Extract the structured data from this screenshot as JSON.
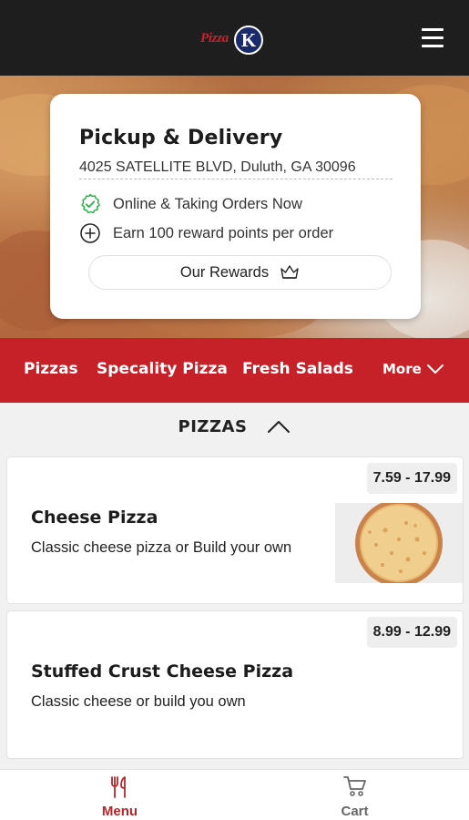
{
  "header": {
    "logo_text": "Pizza",
    "logo_letter": "K",
    "menu_icon": "hamburger-icon"
  },
  "store_card": {
    "title": "Pickup & Delivery",
    "address": "4025 SATELLITE BLVD, Duluth, GA 30096",
    "status_online": "Online & Taking Orders Now",
    "status_rewards": "Earn 100 reward points per order",
    "rewards_button": "Our Rewards",
    "online_color": "#2db24a"
  },
  "categories": {
    "items": [
      "Pizzas",
      "Specality Pizza",
      "Fresh Salads"
    ],
    "more_label": "More",
    "bar_color": "#c62128"
  },
  "section": {
    "title": "PIZZAS"
  },
  "menu_items": [
    {
      "name": "Cheese Pizza",
      "description": "Classic cheese pizza or Build your own",
      "price": "7.59 - 17.99",
      "has_image": true
    },
    {
      "name": "Stuffed Crust Cheese Pizza",
      "description": "Classic cheese or build you own",
      "price": "8.99 - 12.99",
      "has_image": false
    }
  ],
  "bottom_nav": {
    "menu_label": "Menu",
    "cart_label": "Cart",
    "active_color": "#b3262c",
    "inactive_color": "#666666"
  }
}
